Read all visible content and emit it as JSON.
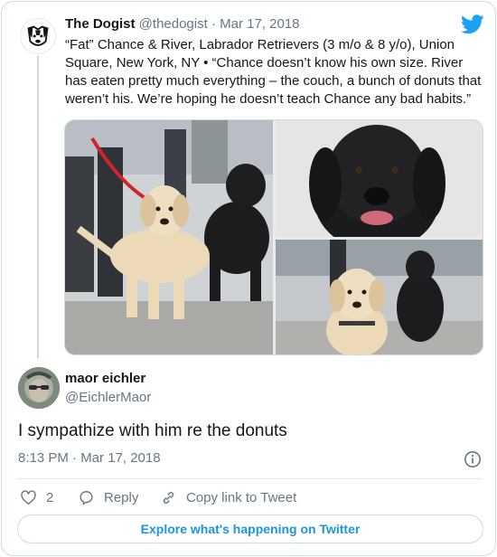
{
  "parent": {
    "author_name": "The Dogist",
    "author_handle": "@thedogist",
    "separator": " · ",
    "date": "Mar 17, 2018",
    "text": "“Fat” Chance & River, Labrador Retrievers (3 m/o & 8 y/o), Union Square, New York, NY • “Chance doesn’t know his own size. River has eaten pretty much everything – the couch, a bunch of donuts that weren’t his. We’re hoping he doesn’t teach Chance any bad habits.”",
    "media": [
      {
        "icon": "photo-yellow-and-black-lab-standing"
      },
      {
        "icon": "photo-black-lab-closeup"
      },
      {
        "icon": "photo-yellow-puppy-and-black-lab"
      }
    ]
  },
  "reply": {
    "author_name": "maor eichler",
    "author_handle": "@EichlerMaor",
    "text": "I sympathize with him re the donuts",
    "time": "8:13 PM · Mar 17, 2018"
  },
  "actions": {
    "like_count": "2",
    "reply_label": "Reply",
    "copy_label": "Copy link to Tweet"
  },
  "footer": {
    "explore_label": "Explore what's happening on Twitter"
  },
  "colors": {
    "accent": "#1b95e0",
    "secondary_text": "#657786",
    "border": "#cfd9de"
  }
}
